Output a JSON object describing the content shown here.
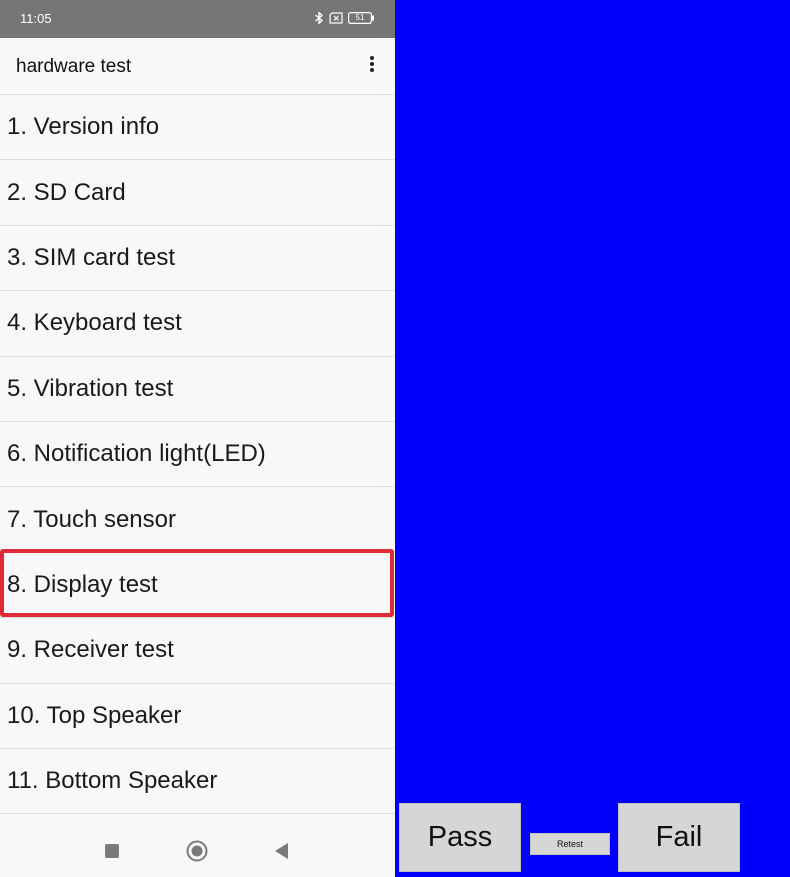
{
  "status_bar": {
    "time": "11:05",
    "icons": [
      "bluetooth-icon",
      "no-sim-icon",
      "battery-icon"
    ],
    "battery_level": "51"
  },
  "app_bar": {
    "title": "hardware test",
    "menu_icon": "more-vert-icon"
  },
  "test_list": {
    "items": [
      "1. Version info",
      "2. SD Card",
      "3. SIM card test",
      "4. Keyboard test",
      "5. Vibration test",
      "6. Notification light(LED)",
      "7. Touch sensor",
      "8. Display test",
      "9. Receiver test",
      "10. Top Speaker",
      "11. Bottom Speaker"
    ],
    "highlighted_index": 7,
    "highlight_color": "#e02a35"
  },
  "nav_bar": {
    "icons": [
      "recents-square-icon",
      "home-circle-icon",
      "back-triangle-icon"
    ]
  },
  "display_test": {
    "fill_color": "#0000ff",
    "pass_label": "Pass",
    "retest_label": "Retest",
    "fail_label": "Fail"
  }
}
